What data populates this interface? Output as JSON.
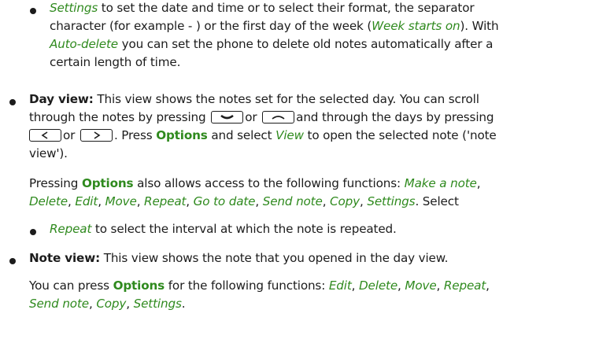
{
  "settings_bullet": {
    "term": "Settings",
    "text1": " to set the date and time or to select their format, the separator",
    "text2a": "character (for example - ) or the first day of the week (",
    "term2": "Week starts on",
    "text2b": "). With",
    "term3": "Auto-delete",
    "text3": " you can set the phone to delete old notes automatically after a",
    "text4": "certain length of time."
  },
  "day_view": {
    "title": "Day view:",
    "text1": " This view shows the notes set for the selected day. You can scroll",
    "text2a": "through the notes by pressing",
    "text2b": "or",
    "text2c": "and through the days by pressing",
    "text3a": "or",
    "text3b": ". Press ",
    "options": "Options",
    "text3c": " and select ",
    "view": "View",
    "text3d": " to open the selected note ('note",
    "text4": "view').",
    "para_a": "Pressing ",
    "para_options": "Options",
    "para_b": " also allows access to the following functions: ",
    "fn_make": "Make a note",
    "fn_delete": "Delete",
    "fn_edit": "Edit",
    "fn_move": "Move",
    "fn_repeat": "Repeat",
    "fn_goto": "Go to date",
    "fn_send": "Send note",
    "fn_copy": "Copy",
    "fn_settings": "Settings",
    "select": ". Select",
    "sub_term": "Repeat",
    "sub_text": " to select the interval at which the note is repeated."
  },
  "note_view": {
    "title": "Note view:",
    "text1": " This view shows the note that you opened in the day view.",
    "para_a": "You can press ",
    "para_options": "Options",
    "para_b": " for the following functions: ",
    "fn_edit": "Edit",
    "fn_delete": "Delete",
    "fn_move": "Move",
    "fn_repeat": "Repeat",
    "fn_send": "Send note",
    "fn_copy": "Copy",
    "fn_settings": "Settings",
    "end": "."
  },
  "icons": {
    "scroll_down_key": "scroll-down-key-icon",
    "scroll_up_key": "scroll-up-key-icon",
    "left_key": "left-arrow-key-icon",
    "right_key": "right-arrow-key-icon"
  },
  "colors": {
    "text": "#1c1c1c",
    "accent": "#2f8a1e"
  }
}
